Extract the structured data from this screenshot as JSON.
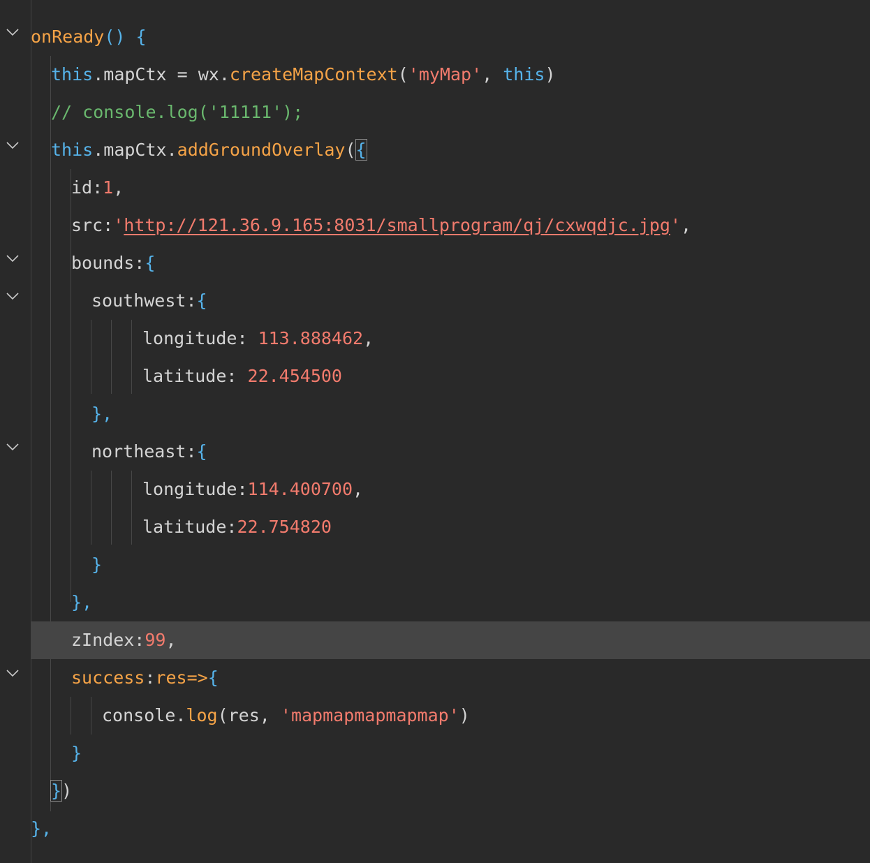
{
  "lines": [
    {
      "tokens": [
        "onReady",
        "() {"
      ]
    },
    {
      "tokens": [
        "this",
        ".mapCtx = wx.",
        "createMapContext",
        "(",
        "'myMap'",
        ", ",
        "this",
        ")"
      ]
    },
    {
      "tokens": [
        "// console.log('11111');"
      ]
    },
    {
      "tokens": [
        "this",
        ".mapCtx.",
        "addGroundOverlay",
        "(",
        "{"
      ]
    },
    {
      "tokens": [
        "id:",
        "1",
        ","
      ]
    },
    {
      "tokens": [
        "src:",
        "'",
        "http://121.36.9.165:8031/smallprogram/qj/cxwqdjc.jpg",
        "'",
        ","
      ]
    },
    {
      "tokens": [
        "bounds:",
        "{"
      ]
    },
    {
      "tokens": [
        "southwest:",
        "{"
      ]
    },
    {
      "tokens": [
        "longitude: ",
        "113.888462",
        ","
      ]
    },
    {
      "tokens": [
        "latitude: ",
        "22.454500"
      ]
    },
    {
      "tokens": [
        "},"
      ]
    },
    {
      "tokens": [
        "northeast:",
        "{"
      ]
    },
    {
      "tokens": [
        "longitude:",
        "114.400700",
        ","
      ]
    },
    {
      "tokens": [
        "latitude:",
        "22.754820"
      ]
    },
    {
      "tokens": [
        "}"
      ]
    },
    {
      "tokens": [
        "},"
      ]
    },
    {
      "tokens": [
        "zIndex:",
        "99",
        ","
      ]
    },
    {
      "tokens": [
        "success",
        ":",
        "res",
        "=>",
        "{"
      ]
    },
    {
      "tokens": [
        "console.",
        "log",
        "(res, ",
        "'mapmapmapmapmap'",
        ")"
      ]
    },
    {
      "tokens": [
        "}"
      ]
    },
    {
      "tokens": [
        "}",
        ")"
      ]
    },
    {
      "tokens": [
        "},"
      ]
    }
  ],
  "fold_icon": "chevron-down-icon",
  "colors": {
    "background": "#292929",
    "current_line": "#454545",
    "keyword": "#56b3ea",
    "function": "#f5a347",
    "string": "#f27b6d",
    "comment": "#6ab86e",
    "plain": "#d4d4d4"
  }
}
